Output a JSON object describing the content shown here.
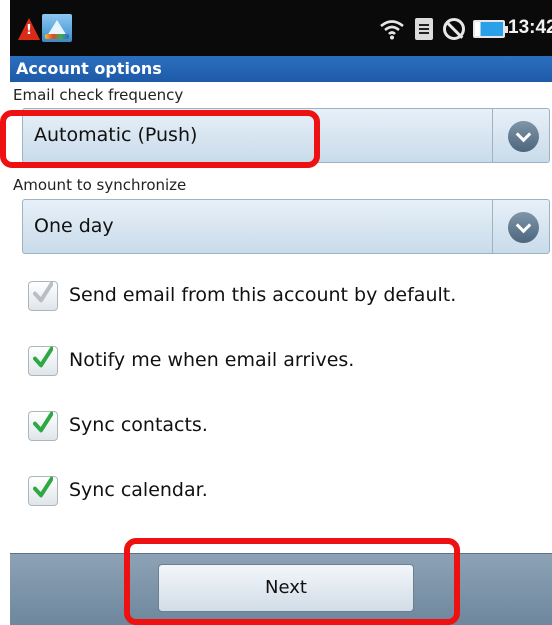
{
  "status_bar": {
    "time": "13:42",
    "icons": [
      "warning-icon",
      "app-notification-icon",
      "wifi-icon",
      "sim-icon",
      "blocked-icon",
      "battery-icon"
    ]
  },
  "title_bar": {
    "title": "Account options"
  },
  "email_check_frequency": {
    "label": "Email check frequency",
    "selected": "Automatic (Push)"
  },
  "amount_to_synchronize": {
    "label": "Amount to synchronize",
    "selected": "One day"
  },
  "checkboxes": [
    {
      "label": "Send email from this account by default.",
      "checked": true,
      "enabled": false
    },
    {
      "label": "Notify me when email arrives.",
      "checked": true,
      "enabled": true
    },
    {
      "label": "Sync contacts.",
      "checked": true,
      "enabled": true
    },
    {
      "label": "Sync calendar.",
      "checked": true,
      "enabled": true
    }
  ],
  "footer": {
    "next_label": "Next"
  },
  "colors": {
    "title_bar": "#1d5aa8",
    "check_enabled": "#2ea844",
    "check_disabled": "#b9bec3",
    "highlight": "#ee1111"
  }
}
